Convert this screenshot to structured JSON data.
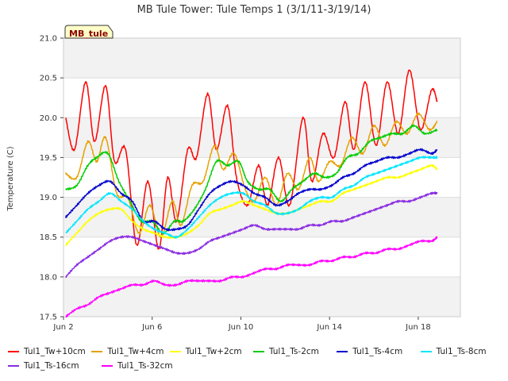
{
  "chart_data": {
    "type": "line",
    "title": "MB Tule Tower: Tule Temps 1 (3/1/11-3/19/14)",
    "xlabel": "",
    "ylabel": "Temperature (C)",
    "badge": "MB_tule",
    "xlim": [
      2.0,
      19.9
    ],
    "ylim": [
      17.5,
      21.0
    ],
    "xticks": [
      {
        "value": 2,
        "label": "Jun 2"
      },
      {
        "value": 6,
        "label": "Jun 6"
      },
      {
        "value": 10,
        "label": "Jun 10"
      },
      {
        "value": 14,
        "label": "Jun 14"
      },
      {
        "value": 18,
        "label": "Jun 18"
      }
    ],
    "yticks": [
      {
        "value": 17.5,
        "label": "17.5"
      },
      {
        "value": 18.0,
        "label": "18.0"
      },
      {
        "value": 18.5,
        "label": "18.5"
      },
      {
        "value": 19.0,
        "label": "19.0"
      },
      {
        "value": 19.5,
        "label": "19.5"
      },
      {
        "value": 20.0,
        "label": "20.0"
      },
      {
        "value": 20.5,
        "label": "20.5"
      },
      {
        "value": 21.0,
        "label": "21.0"
      }
    ],
    "bands": [
      [
        17.5,
        18.0
      ],
      [
        18.5,
        19.0
      ],
      [
        19.5,
        20.0
      ],
      [
        20.5,
        21.0
      ]
    ],
    "series": [
      {
        "name": "Tul1_Tw+10cm",
        "color": "#ff0000",
        "points": [
          [
            2.1,
            20.0
          ],
          [
            2.5,
            19.6
          ],
          [
            3.0,
            20.45
          ],
          [
            3.4,
            19.7
          ],
          [
            3.9,
            20.4
          ],
          [
            4.3,
            19.45
          ],
          [
            4.8,
            19.6
          ],
          [
            5.3,
            18.4
          ],
          [
            5.8,
            19.2
          ],
          [
            6.3,
            18.35
          ],
          [
            6.7,
            19.25
          ],
          [
            7.1,
            18.7
          ],
          [
            7.6,
            19.6
          ],
          [
            8.0,
            19.5
          ],
          [
            8.5,
            20.3
          ],
          [
            8.9,
            19.6
          ],
          [
            9.4,
            20.15
          ],
          [
            9.8,
            19.25
          ],
          [
            10.3,
            18.9
          ],
          [
            10.8,
            19.4
          ],
          [
            11.2,
            18.9
          ],
          [
            11.7,
            19.5
          ],
          [
            12.2,
            18.9
          ],
          [
            12.8,
            20.0
          ],
          [
            13.2,
            19.2
          ],
          [
            13.7,
            19.8
          ],
          [
            14.2,
            19.5
          ],
          [
            14.7,
            20.2
          ],
          [
            15.1,
            19.6
          ],
          [
            15.6,
            20.45
          ],
          [
            16.1,
            19.65
          ],
          [
            16.6,
            20.45
          ],
          [
            17.1,
            19.8
          ],
          [
            17.6,
            20.6
          ],
          [
            18.1,
            19.85
          ],
          [
            18.6,
            20.35
          ],
          [
            18.85,
            20.2
          ]
        ]
      },
      {
        "name": "Tul1_Tw+4cm",
        "color": "#e6a000",
        "points": [
          [
            2.1,
            19.3
          ],
          [
            2.6,
            19.25
          ],
          [
            3.1,
            19.7
          ],
          [
            3.5,
            19.45
          ],
          [
            3.9,
            19.75
          ],
          [
            4.4,
            19.05
          ],
          [
            4.9,
            19.0
          ],
          [
            5.4,
            18.55
          ],
          [
            5.9,
            18.9
          ],
          [
            6.4,
            18.5
          ],
          [
            6.9,
            18.95
          ],
          [
            7.3,
            18.65
          ],
          [
            7.8,
            19.15
          ],
          [
            8.3,
            19.2
          ],
          [
            8.8,
            19.65
          ],
          [
            9.2,
            19.35
          ],
          [
            9.7,
            19.55
          ],
          [
            10.2,
            19.1
          ],
          [
            10.6,
            18.95
          ],
          [
            11.1,
            19.25
          ],
          [
            11.6,
            18.9
          ],
          [
            12.1,
            19.3
          ],
          [
            12.6,
            19.1
          ],
          [
            13.1,
            19.5
          ],
          [
            13.5,
            19.2
          ],
          [
            14.0,
            19.45
          ],
          [
            14.5,
            19.4
          ],
          [
            15.0,
            19.75
          ],
          [
            15.5,
            19.55
          ],
          [
            16.0,
            19.9
          ],
          [
            16.5,
            19.65
          ],
          [
            17.0,
            19.95
          ],
          [
            17.5,
            19.8
          ],
          [
            18.0,
            20.05
          ],
          [
            18.5,
            19.85
          ],
          [
            18.85,
            19.95
          ]
        ]
      },
      {
        "name": "Tul1_Tw+2cm",
        "color": "#ffff00",
        "points": [
          [
            2.1,
            18.4
          ],
          [
            2.6,
            18.55
          ],
          [
            3.1,
            18.7
          ],
          [
            3.6,
            18.8
          ],
          [
            4.1,
            18.85
          ],
          [
            4.6,
            18.85
          ],
          [
            5.1,
            18.7
          ],
          [
            5.6,
            18.6
          ],
          [
            6.1,
            18.55
          ],
          [
            6.6,
            18.5
          ],
          [
            7.1,
            18.5
          ],
          [
            7.6,
            18.55
          ],
          [
            8.1,
            18.65
          ],
          [
            8.6,
            18.8
          ],
          [
            9.1,
            18.85
          ],
          [
            9.6,
            18.9
          ],
          [
            10.1,
            18.95
          ],
          [
            10.6,
            18.9
          ],
          [
            11.1,
            18.85
          ],
          [
            11.6,
            18.8
          ],
          [
            12.1,
            18.8
          ],
          [
            12.6,
            18.85
          ],
          [
            13.1,
            18.9
          ],
          [
            13.6,
            18.95
          ],
          [
            14.1,
            18.95
          ],
          [
            14.6,
            19.05
          ],
          [
            15.1,
            19.1
          ],
          [
            15.6,
            19.15
          ],
          [
            16.1,
            19.2
          ],
          [
            16.6,
            19.25
          ],
          [
            17.1,
            19.25
          ],
          [
            17.6,
            19.3
          ],
          [
            18.1,
            19.35
          ],
          [
            18.6,
            19.4
          ],
          [
            18.85,
            19.35
          ]
        ]
      },
      {
        "name": "Tul1_Ts-2cm",
        "color": "#00cc00",
        "points": [
          [
            2.1,
            19.1
          ],
          [
            2.6,
            19.15
          ],
          [
            3.1,
            19.4
          ],
          [
            3.5,
            19.5
          ],
          [
            4.0,
            19.55
          ],
          [
            4.5,
            19.2
          ],
          [
            5.0,
            18.95
          ],
          [
            5.5,
            18.7
          ],
          [
            6.0,
            18.7
          ],
          [
            6.5,
            18.55
          ],
          [
            7.0,
            18.7
          ],
          [
            7.4,
            18.7
          ],
          [
            7.9,
            18.85
          ],
          [
            8.4,
            19.1
          ],
          [
            8.9,
            19.45
          ],
          [
            9.4,
            19.4
          ],
          [
            9.9,
            19.45
          ],
          [
            10.3,
            19.2
          ],
          [
            10.8,
            19.1
          ],
          [
            11.3,
            19.1
          ],
          [
            11.8,
            18.95
          ],
          [
            12.3,
            19.1
          ],
          [
            12.8,
            19.2
          ],
          [
            13.3,
            19.3
          ],
          [
            13.8,
            19.25
          ],
          [
            14.3,
            19.3
          ],
          [
            14.8,
            19.5
          ],
          [
            15.3,
            19.55
          ],
          [
            15.8,
            19.7
          ],
          [
            16.3,
            19.75
          ],
          [
            16.8,
            19.8
          ],
          [
            17.3,
            19.8
          ],
          [
            17.8,
            19.9
          ],
          [
            18.3,
            19.8
          ],
          [
            18.85,
            19.85
          ]
        ]
      },
      {
        "name": "Tul1_Ts-4cm",
        "color": "#0000cc",
        "points": [
          [
            2.1,
            18.75
          ],
          [
            2.6,
            18.9
          ],
          [
            3.1,
            19.05
          ],
          [
            3.6,
            19.15
          ],
          [
            4.1,
            19.2
          ],
          [
            4.6,
            19.05
          ],
          [
            5.1,
            18.95
          ],
          [
            5.6,
            18.7
          ],
          [
            6.1,
            18.7
          ],
          [
            6.6,
            18.6
          ],
          [
            7.1,
            18.6
          ],
          [
            7.6,
            18.65
          ],
          [
            8.1,
            18.85
          ],
          [
            8.6,
            19.05
          ],
          [
            9.1,
            19.15
          ],
          [
            9.6,
            19.2
          ],
          [
            10.1,
            19.15
          ],
          [
            10.6,
            19.05
          ],
          [
            11.1,
            19.0
          ],
          [
            11.6,
            18.9
          ],
          [
            12.1,
            18.95
          ],
          [
            12.6,
            19.05
          ],
          [
            13.1,
            19.1
          ],
          [
            13.6,
            19.1
          ],
          [
            14.1,
            19.15
          ],
          [
            14.6,
            19.25
          ],
          [
            15.1,
            19.3
          ],
          [
            15.6,
            19.4
          ],
          [
            16.1,
            19.45
          ],
          [
            16.6,
            19.5
          ],
          [
            17.1,
            19.5
          ],
          [
            17.6,
            19.55
          ],
          [
            18.1,
            19.6
          ],
          [
            18.6,
            19.55
          ],
          [
            18.85,
            19.6
          ]
        ]
      },
      {
        "name": "Tul1_Ts-8cm",
        "color": "#00e5ff",
        "points": [
          [
            2.1,
            18.55
          ],
          [
            2.6,
            18.7
          ],
          [
            3.1,
            18.85
          ],
          [
            3.6,
            18.95
          ],
          [
            4.1,
            19.05
          ],
          [
            4.6,
            18.95
          ],
          [
            5.1,
            18.85
          ],
          [
            5.6,
            18.7
          ],
          [
            6.1,
            18.6
          ],
          [
            6.6,
            18.55
          ],
          [
            7.1,
            18.5
          ],
          [
            7.6,
            18.6
          ],
          [
            8.1,
            18.75
          ],
          [
            8.6,
            18.9
          ],
          [
            9.1,
            19.0
          ],
          [
            9.6,
            19.05
          ],
          [
            10.1,
            19.05
          ],
          [
            10.6,
            18.95
          ],
          [
            11.1,
            18.9
          ],
          [
            11.6,
            18.8
          ],
          [
            12.1,
            18.8
          ],
          [
            12.6,
            18.85
          ],
          [
            13.1,
            18.95
          ],
          [
            13.6,
            19.0
          ],
          [
            14.1,
            19.0
          ],
          [
            14.6,
            19.1
          ],
          [
            15.1,
            19.15
          ],
          [
            15.6,
            19.25
          ],
          [
            16.1,
            19.3
          ],
          [
            16.6,
            19.35
          ],
          [
            17.1,
            19.4
          ],
          [
            17.6,
            19.45
          ],
          [
            18.1,
            19.5
          ],
          [
            18.6,
            19.5
          ],
          [
            18.85,
            19.5
          ]
        ]
      },
      {
        "name": "Tul1_Ts-16cm",
        "color": "#8a2be2",
        "points": [
          [
            2.1,
            18.0
          ],
          [
            2.6,
            18.15
          ],
          [
            3.1,
            18.25
          ],
          [
            3.6,
            18.35
          ],
          [
            4.1,
            18.45
          ],
          [
            4.6,
            18.5
          ],
          [
            5.1,
            18.5
          ],
          [
            5.6,
            18.45
          ],
          [
            6.1,
            18.4
          ],
          [
            6.6,
            18.35
          ],
          [
            7.1,
            18.3
          ],
          [
            7.6,
            18.3
          ],
          [
            8.1,
            18.35
          ],
          [
            8.6,
            18.45
          ],
          [
            9.1,
            18.5
          ],
          [
            9.6,
            18.55
          ],
          [
            10.1,
            18.6
          ],
          [
            10.6,
            18.65
          ],
          [
            11.1,
            18.6
          ],
          [
            11.6,
            18.6
          ],
          [
            12.1,
            18.6
          ],
          [
            12.6,
            18.6
          ],
          [
            13.1,
            18.65
          ],
          [
            13.6,
            18.65
          ],
          [
            14.1,
            18.7
          ],
          [
            14.6,
            18.7
          ],
          [
            15.1,
            18.75
          ],
          [
            15.6,
            18.8
          ],
          [
            16.1,
            18.85
          ],
          [
            16.6,
            18.9
          ],
          [
            17.1,
            18.95
          ],
          [
            17.6,
            18.95
          ],
          [
            18.1,
            19.0
          ],
          [
            18.6,
            19.05
          ],
          [
            18.85,
            19.05
          ]
        ]
      },
      {
        "name": "Tul1_Ts-32cm",
        "color": "#ff00ff",
        "points": [
          [
            2.1,
            17.5
          ],
          [
            2.6,
            17.6
          ],
          [
            3.1,
            17.65
          ],
          [
            3.6,
            17.75
          ],
          [
            4.1,
            17.8
          ],
          [
            4.6,
            17.85
          ],
          [
            5.1,
            17.9
          ],
          [
            5.6,
            17.9
          ],
          [
            6.1,
            17.95
          ],
          [
            6.6,
            17.9
          ],
          [
            7.1,
            17.9
          ],
          [
            7.6,
            17.95
          ],
          [
            8.1,
            17.95
          ],
          [
            8.6,
            17.95
          ],
          [
            9.1,
            17.95
          ],
          [
            9.6,
            18.0
          ],
          [
            10.1,
            18.0
          ],
          [
            10.6,
            18.05
          ],
          [
            11.1,
            18.1
          ],
          [
            11.6,
            18.1
          ],
          [
            12.1,
            18.15
          ],
          [
            12.6,
            18.15
          ],
          [
            13.1,
            18.15
          ],
          [
            13.6,
            18.2
          ],
          [
            14.1,
            18.2
          ],
          [
            14.6,
            18.25
          ],
          [
            15.1,
            18.25
          ],
          [
            15.6,
            18.3
          ],
          [
            16.1,
            18.3
          ],
          [
            16.6,
            18.35
          ],
          [
            17.1,
            18.35
          ],
          [
            17.6,
            18.4
          ],
          [
            18.1,
            18.45
          ],
          [
            18.6,
            18.45
          ],
          [
            18.85,
            18.5
          ]
        ]
      }
    ]
  }
}
